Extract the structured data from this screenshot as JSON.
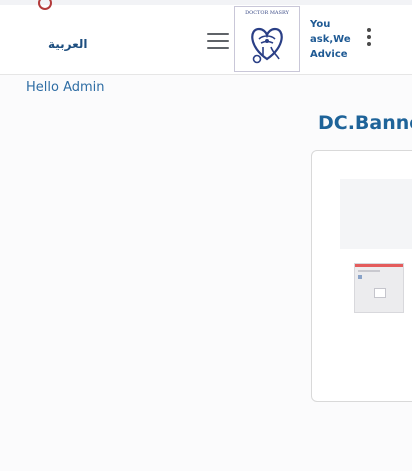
{
  "header": {
    "language_label": "العربية",
    "logo_text": "DOCTOR MASRY",
    "tagline": "You ask,We Advice"
  },
  "greeting": "Hello Admin",
  "page_title": "DC.Banne"
}
